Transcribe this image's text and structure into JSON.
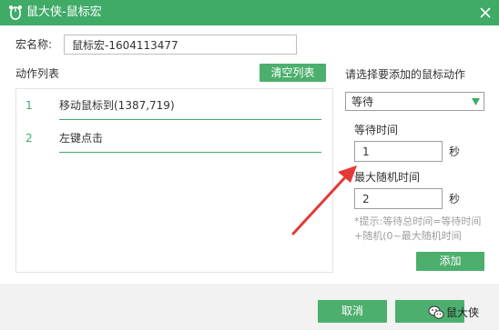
{
  "window": {
    "title": "鼠大侠-鼠标宏",
    "logo_icon": "mouse-icon",
    "close_icon": "close-icon"
  },
  "macro_name": {
    "label": "宏名称:",
    "value": "鼠标宏-1604113477"
  },
  "action_list": {
    "label": "动作列表",
    "clear_button": "清空列表",
    "items": [
      {
        "index": "1",
        "text": "移动鼠标到(1387,719)"
      },
      {
        "index": "2",
        "text": "左键点击"
      }
    ]
  },
  "add_panel": {
    "prompt": "请选择要添加的鼠标动作",
    "selected_action": "等待",
    "wait_time_label": "等待时间",
    "wait_time_value": "1",
    "wait_time_unit": "秒",
    "max_random_label": "最大随机时间",
    "max_random_value": "2",
    "max_random_unit": "秒",
    "hint": "*提示:等待总时间=等待时间+随机(0~最大随机时间",
    "add_button": "添加"
  },
  "footer": {
    "cancel_button": "取消"
  },
  "watermark": {
    "text": "鼠大侠",
    "icon": "wechat-icon"
  },
  "colors": {
    "brand_green": "#3fab67",
    "button_green": "#4caf6d",
    "annotation_red": "#e53935"
  }
}
